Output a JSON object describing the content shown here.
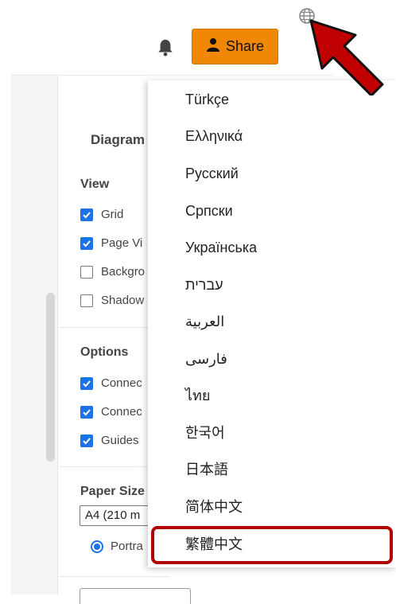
{
  "toolbar": {
    "share_label": "Share",
    "icons": [
      "globe-icon",
      "bell-icon",
      "user-icon"
    ],
    "share_color": "#f08705"
  },
  "panel": {
    "title": "Diagram",
    "view_heading": "View",
    "view_items": [
      {
        "label": "Grid",
        "checked": true
      },
      {
        "label": "Page Vi",
        "checked": true
      },
      {
        "label": "Backgro",
        "checked": false
      },
      {
        "label": "Shadow",
        "checked": false
      }
    ],
    "options_heading": "Options",
    "options_items": [
      {
        "label": "Connec",
        "checked": true
      },
      {
        "label": "Connec",
        "checked": true
      },
      {
        "label": "Guides",
        "checked": true
      }
    ],
    "paper_size_heading": "Paper Size",
    "paper_size_value": "A4 (210 m",
    "orientation_label": "Portra"
  },
  "language_menu": {
    "items": [
      "Türkçe",
      "Ελληνικά",
      "Русский",
      "Српски",
      "Українська",
      "עברית",
      "العربية",
      "فارسی",
      "ไทย",
      "한국어",
      "日本語",
      "简体中文",
      "繁體中文"
    ],
    "highlighted": "繁體中文",
    "highlight_color": "#b00000"
  },
  "annotation": {
    "arrow_color": "#c00000"
  }
}
